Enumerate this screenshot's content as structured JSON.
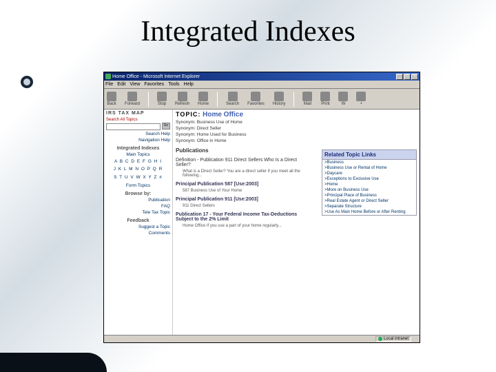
{
  "slide_title": "Integrated Indexes",
  "titlebar": "Home Office - Microsoft Internet Explorer",
  "win": {
    "min": "_",
    "max": "□",
    "close": "×"
  },
  "menu": [
    "File",
    "Edit",
    "View",
    "Favorites",
    "Tools",
    "Help"
  ],
  "toolbar": [
    "Back",
    "Forward",
    "Stop",
    "Refresh",
    "Home",
    "Search",
    "Favorites",
    "History",
    "Mail",
    "Print",
    "W",
    "•"
  ],
  "sidebar": {
    "logo": "IRS TAX MAP",
    "search_label": "Search All Topics",
    "go": "Go",
    "links1": [
      "Search Help",
      "Navigation Help"
    ],
    "head1": "Integrated Indexes",
    "sub1": "Main Topics",
    "alpha": [
      "A B C D E F G H I",
      "J K L M N O P Q R",
      "S T U V W X Y Z #"
    ],
    "sub2": "Form Topics",
    "browse_head": "Browse by:",
    "browse": [
      "Publication",
      "FAQ",
      "Tele Tax Topic"
    ],
    "fb_head": "Feedback",
    "fb": [
      "Suggest a Topic",
      "Comments"
    ]
  },
  "topic": {
    "label": "TOPIC:",
    "name": "Home Office",
    "synonyms": [
      "Synonym: Business Use of Home",
      "Synonym: Direct Seller",
      "Synonym: Home Used for Business",
      "Synonym: Office in Home"
    ]
  },
  "publications_label": "Publications",
  "pubs": [
    {
      "head": "Definition - Publication 911 Direct Sellers Who Is a Direct Seller?",
      "body": "What is a Direct Seller? You are a direct seller if you meet all the following..."
    },
    {
      "head": "Principal Publication 587 [Use:2003]",
      "body": "587 Business Use of Your Home"
    },
    {
      "head": "Principal Publication 911 [Use:2003]",
      "body": "911 Direct Sellers"
    },
    {
      "head": "Publication 17 - Your Federal Income Tax-Deductions Subject to the 2% Limit",
      "body": "Home Office If you use a part of your home regularly..."
    }
  ],
  "related": {
    "title": "Related Topic Links",
    "items": [
      ">Business",
      ">Business Use or Rental of Home",
      ">Daycare",
      ">Exceptions to Exclusive Use",
      ">Home",
      ">More on Business Use",
      ">Principal Place of Business",
      ">Real Estate Agent or Direct Seller",
      ">Separate Structure",
      ">Use As Main Home Before or After Renting"
    ]
  },
  "status_zone": "Local intranet"
}
